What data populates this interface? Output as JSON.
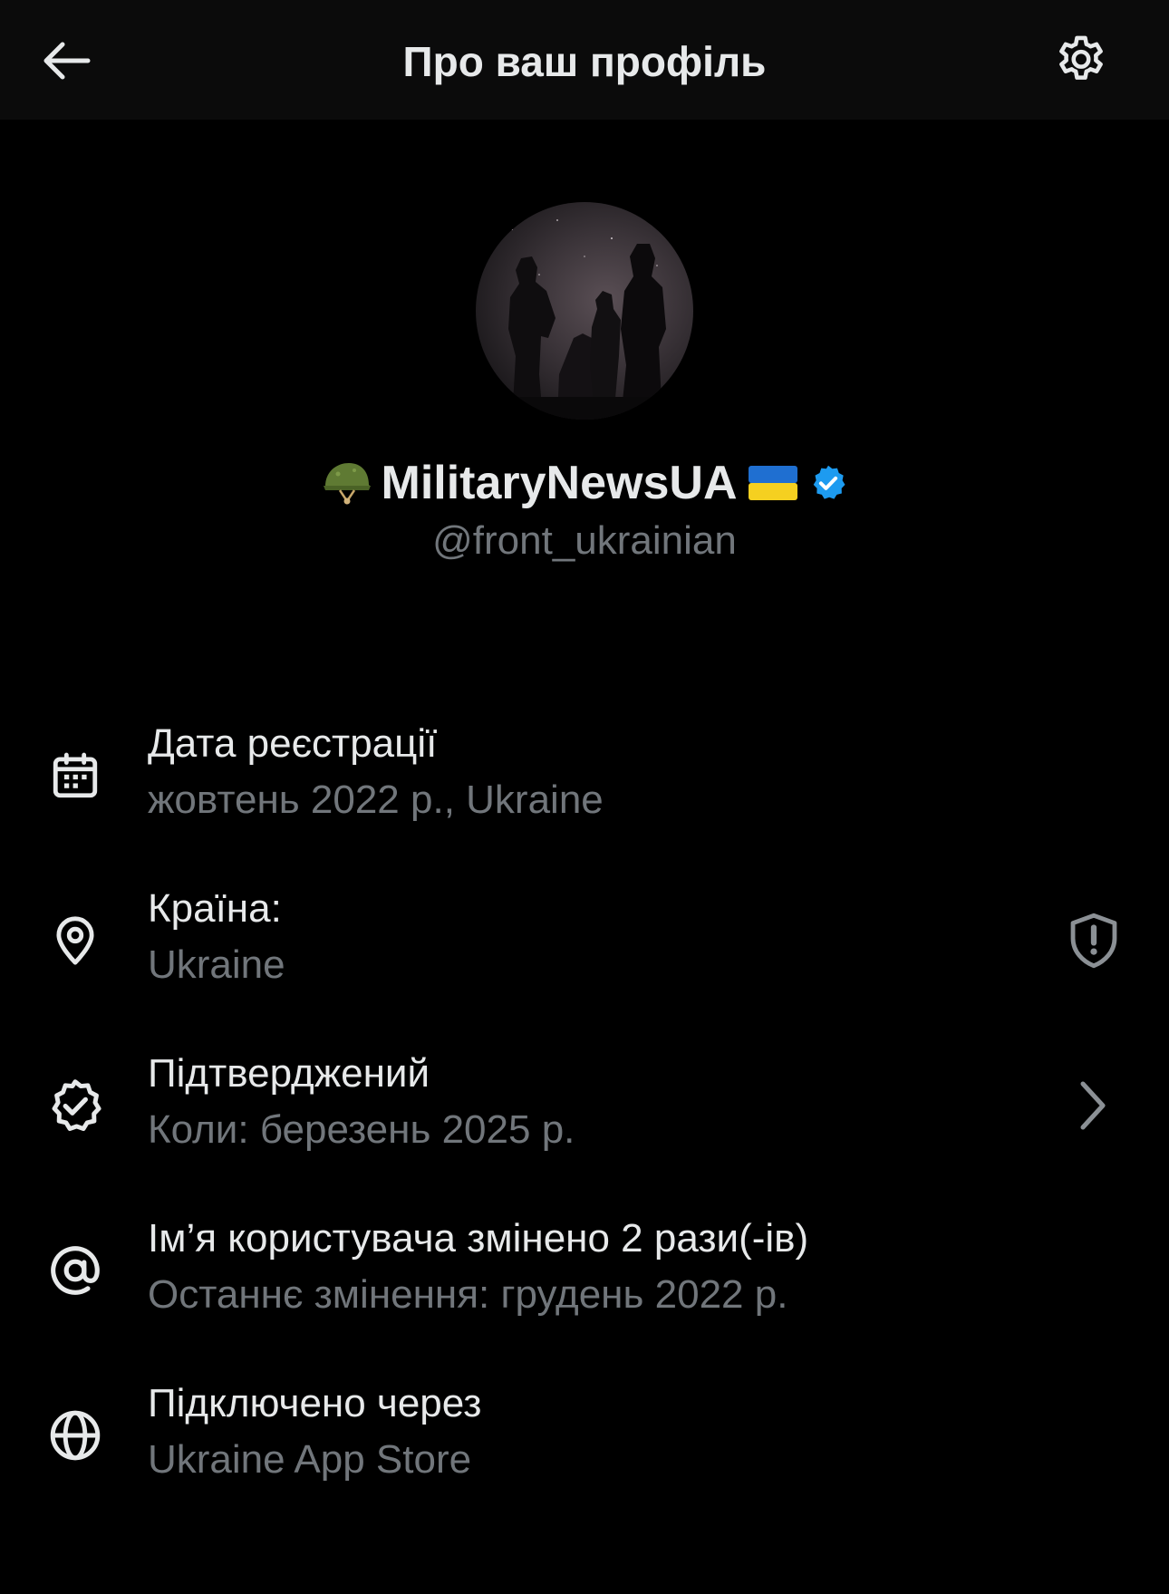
{
  "header": {
    "title": "Про ваш профіль",
    "back_icon": "arrow-left-icon",
    "settings_icon": "gear-icon"
  },
  "profile": {
    "display_name": "MilitaryNewsUA",
    "handle": "@front_ukrainian",
    "prefix_emoji": "helmet-emoji",
    "suffix_emoji": "ukraine-flag-emoji",
    "verified_icon": "verified-badge-icon",
    "verified_color": "#1d9bf0",
    "avatar": "avatar-image"
  },
  "info": [
    {
      "icon": "calendar-icon",
      "title": "Дата реєстрації",
      "subtitle": "жовтень 2022 р., Ukraine"
    },
    {
      "icon": "location-pin-icon",
      "title": "Країна:",
      "subtitle": "Ukraine",
      "trailing_icon": "shield-alert-icon"
    },
    {
      "icon": "verified-outline-icon",
      "title": "Підтверджений",
      "subtitle": "Коли: березень 2025 р.",
      "trailing_icon": "chevron-right-icon"
    },
    {
      "icon": "at-sign-icon",
      "title": "Ім’я користувача змінено 2 рази(-ів)",
      "subtitle": "Останнє змінення: грудень 2022 р."
    },
    {
      "icon": "globe-icon",
      "title": "Підключено через",
      "subtitle": "Ukraine App Store"
    }
  ],
  "colors": {
    "background": "#000000",
    "topbar": "#0b0b0b",
    "primary_text": "#e7e9ea",
    "secondary_text": "#71767b",
    "accent": "#1d9bf0"
  }
}
